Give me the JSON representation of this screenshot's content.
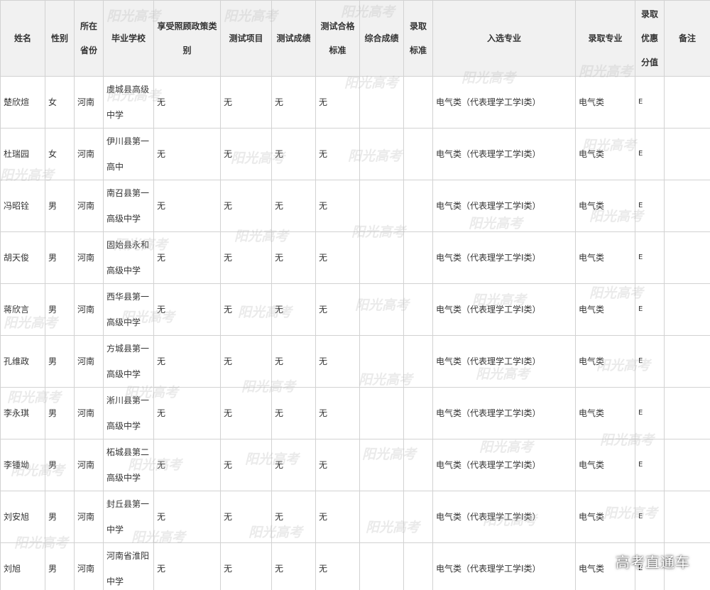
{
  "headers": [
    "姓名",
    "性别",
    "所在省份",
    "毕业学校",
    "享受照顾政策类别",
    "测试项目",
    "测试成绩",
    "测试合格标准",
    "综合成绩",
    "录取标准",
    "入选专业",
    "录取专业",
    "录取优惠分值",
    "备注"
  ],
  "rows": [
    {
      "name": "楚欣煊",
      "gender": "女",
      "province": "河南",
      "school": "虞城县高级中学",
      "policy": "无",
      "test_item": "无",
      "test_score": "无",
      "test_standard": "无",
      "composite": "",
      "admit_standard": "",
      "selected_major": "电气类（代表理学工学I类）",
      "admitted_major": "电气类",
      "bonus": "E",
      "note": ""
    },
    {
      "name": "杜瑞园",
      "gender": "女",
      "province": "河南",
      "school": "伊川县第一高中",
      "policy": "无",
      "test_item": "无",
      "test_score": "无",
      "test_standard": "无",
      "composite": "",
      "admit_standard": "",
      "selected_major": "电气类（代表理学工学I类）",
      "admitted_major": "电气类",
      "bonus": "E",
      "note": ""
    },
    {
      "name": "冯昭铨",
      "gender": "男",
      "province": "河南",
      "school": "南召县第一高级中学",
      "policy": "无",
      "test_item": "无",
      "test_score": "无",
      "test_standard": "无",
      "composite": "",
      "admit_standard": "",
      "selected_major": "电气类（代表理学工学I类）",
      "admitted_major": "电气类",
      "bonus": "E",
      "note": ""
    },
    {
      "name": "胡天俊",
      "gender": "男",
      "province": "河南",
      "school": "固始县永和高级中学",
      "policy": "无",
      "test_item": "无",
      "test_score": "无",
      "test_standard": "无",
      "composite": "",
      "admit_standard": "",
      "selected_major": "电气类（代表理学工学I类）",
      "admitted_major": "电气类",
      "bonus": "E",
      "note": ""
    },
    {
      "name": "蒋欣言",
      "gender": "男",
      "province": "河南",
      "school": "西华县第一高级中学",
      "policy": "无",
      "test_item": "无",
      "test_score": "无",
      "test_standard": "无",
      "composite": "",
      "admit_standard": "",
      "selected_major": "电气类（代表理学工学I类）",
      "admitted_major": "电气类",
      "bonus": "E",
      "note": ""
    },
    {
      "name": "孔维政",
      "gender": "男",
      "province": "河南",
      "school": "方城县第一高级中学",
      "policy": "无",
      "test_item": "无",
      "test_score": "无",
      "test_standard": "无",
      "composite": "",
      "admit_standard": "",
      "selected_major": "电气类（代表理学工学I类）",
      "admitted_major": "电气类",
      "bonus": "E",
      "note": ""
    },
    {
      "name": "李永琪",
      "gender": "男",
      "province": "河南",
      "school": "淅川县第一高级中学",
      "policy": "无",
      "test_item": "无",
      "test_score": "无",
      "test_standard": "无",
      "composite": "",
      "admit_standard": "",
      "selected_major": "电气类（代表理学工学I类）",
      "admitted_major": "电气类",
      "bonus": "E",
      "note": ""
    },
    {
      "name": "李锺坳",
      "gender": "男",
      "province": "河南",
      "school": "柘城县第二高级中学",
      "policy": "无",
      "test_item": "无",
      "test_score": "无",
      "test_standard": "无",
      "composite": "",
      "admit_standard": "",
      "selected_major": "电气类（代表理学工学I类）",
      "admitted_major": "电气类",
      "bonus": "E",
      "note": ""
    },
    {
      "name": "刘安旭",
      "gender": "男",
      "province": "河南",
      "school": "封丘县第一中学",
      "policy": "无",
      "test_item": "无",
      "test_score": "无",
      "test_standard": "无",
      "composite": "",
      "admit_standard": "",
      "selected_major": "电气类（代表理学工学I类）",
      "admitted_major": "电气类",
      "bonus": "E",
      "note": ""
    },
    {
      "name": "刘旭",
      "gender": "男",
      "province": "河南",
      "school": "河南省淮阳中学",
      "policy": "无",
      "test_item": "无",
      "test_score": "无",
      "test_standard": "无",
      "composite": "",
      "admit_standard": "",
      "selected_major": "电气类（代表理学工学I类）",
      "admitted_major": "电气类",
      "bonus": "E",
      "note": ""
    }
  ],
  "watermark": "阳光高考",
  "brand": "高考直通车",
  "colors": {
    "header_bg": "#f1f1f1",
    "border": "#d2d2d2",
    "text": "#333333"
  }
}
